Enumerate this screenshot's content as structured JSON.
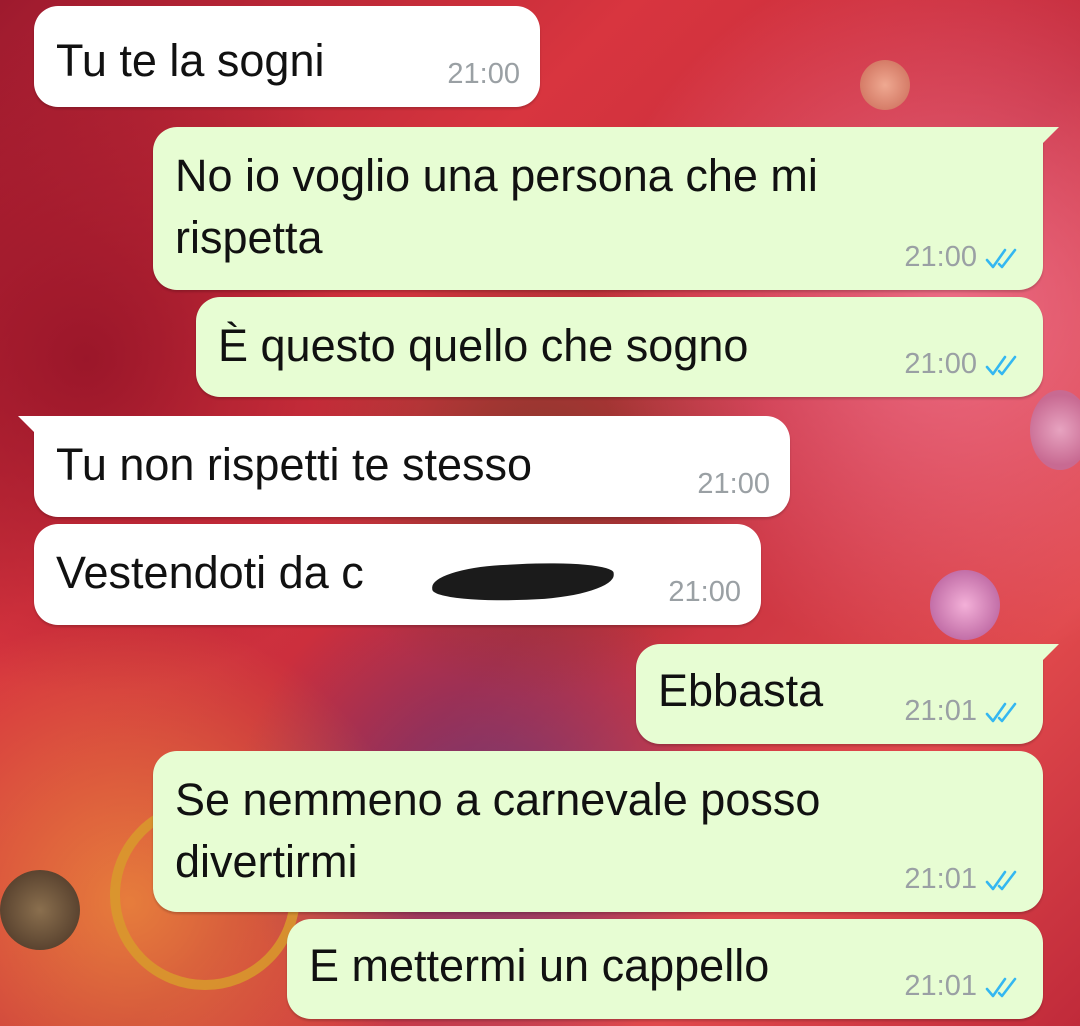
{
  "theme": {
    "incoming_bubble": "#ffffff",
    "outgoing_bubble": "#e7fdd3",
    "text_color": "#111111",
    "time_color": "#9aa0a4",
    "tick_color": "#34b7f1"
  },
  "messages": [
    {
      "text": "Tu te la sogni",
      "time": "21:00",
      "direction": "incoming",
      "status_icon": ""
    },
    {
      "text": "No io voglio una persona che mi\nrispetta",
      "time": "21:00",
      "direction": "outgoing",
      "status_icon": "double-check-icon"
    },
    {
      "text": "È questo quello che sogno",
      "time": "21:00",
      "direction": "outgoing",
      "status_icon": "double-check-icon"
    },
    {
      "text": "Tu non rispetti te stesso",
      "time": "21:00",
      "direction": "incoming",
      "status_icon": ""
    },
    {
      "text": "Vestendoti da c",
      "time": "21:00",
      "direction": "incoming",
      "status_icon": "",
      "redaction_icon": "scribble-redaction-icon"
    },
    {
      "text": "Ebbasta",
      "time": "21:01",
      "direction": "outgoing",
      "status_icon": "double-check-icon"
    },
    {
      "text": "Se nemmeno a carnevale posso\ndivertirmi",
      "time": "21:01",
      "direction": "outgoing",
      "status_icon": "double-check-icon"
    },
    {
      "text": "E mettermi un cappello",
      "time": "21:01",
      "direction": "outgoing",
      "status_icon": "double-check-icon"
    }
  ]
}
